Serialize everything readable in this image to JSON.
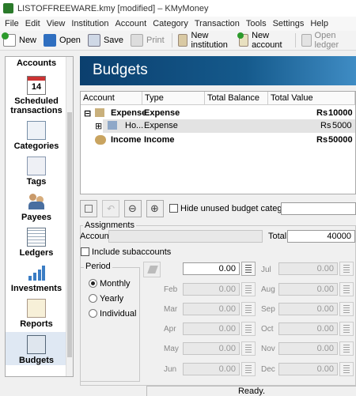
{
  "window": {
    "title": "LISTOFFREEWARE.kmy [modified] – KMyMoney"
  },
  "menu": [
    "File",
    "Edit",
    "View",
    "Institution",
    "Account",
    "Category",
    "Transaction",
    "Tools",
    "Settings",
    "Help"
  ],
  "toolbar": {
    "new": "New",
    "open": "Open",
    "save": "Save",
    "print": "Print",
    "new_institution": "New institution",
    "new_account": "New account",
    "open_ledger": "Open ledger"
  },
  "sidebar": {
    "items": [
      {
        "label": "Accounts",
        "icon": "accounts-icon"
      },
      {
        "label": "Scheduled transactions",
        "icon": "calendar-icon"
      },
      {
        "label": "Categories",
        "icon": "categories-icon"
      },
      {
        "label": "Tags",
        "icon": "tag-icon"
      },
      {
        "label": "Payees",
        "icon": "payees-icon"
      },
      {
        "label": "Ledgers",
        "icon": "ledger-icon"
      },
      {
        "label": "Investments",
        "icon": "investments-icon"
      },
      {
        "label": "Reports",
        "icon": "reports-icon"
      },
      {
        "label": "Budgets",
        "icon": "budgets-icon"
      }
    ],
    "calendar_day": "14"
  },
  "header": {
    "title": "Budgets"
  },
  "tree": {
    "columns": [
      "Account",
      "Type",
      "Total Balance",
      "Total Value"
    ],
    "rows": [
      {
        "name": "Expense",
        "type": "Expense",
        "currency": "Rs",
        "value": "10000"
      },
      {
        "name": "Ho...",
        "type": "Expense",
        "currency": "Rs",
        "value": "5000"
      },
      {
        "name": "Income",
        "type": "Income",
        "currency": "Rs",
        "value": "50000"
      }
    ]
  },
  "budget_toolbar": {
    "hide_unused": "Hide unused budget categories"
  },
  "assignments": {
    "title": "Assignments",
    "account_label": "Account",
    "total_label": "Total",
    "total_value": "40000",
    "include_subaccounts": "Include subaccounts",
    "period_title": "Period",
    "period_options": [
      "Monthly",
      "Yearly",
      "Individual"
    ],
    "selected_period": "Monthly",
    "months": [
      {
        "label": "",
        "value": "0.00"
      },
      {
        "label": "Feb",
        "value": "0.00"
      },
      {
        "label": "Mar",
        "value": "0.00"
      },
      {
        "label": "Apr",
        "value": "0.00"
      },
      {
        "label": "May",
        "value": "0.00"
      },
      {
        "label": "Jun",
        "value": "0.00"
      },
      {
        "label": "Jul",
        "value": "0.00"
      },
      {
        "label": "Aug",
        "value": "0.00"
      },
      {
        "label": "Sep",
        "value": "0.00"
      },
      {
        "label": "Oct",
        "value": "0.00"
      },
      {
        "label": "Nov",
        "value": "0.00"
      },
      {
        "label": "Dec",
        "value": "0.00"
      }
    ]
  },
  "status": {
    "text": "Ready."
  }
}
